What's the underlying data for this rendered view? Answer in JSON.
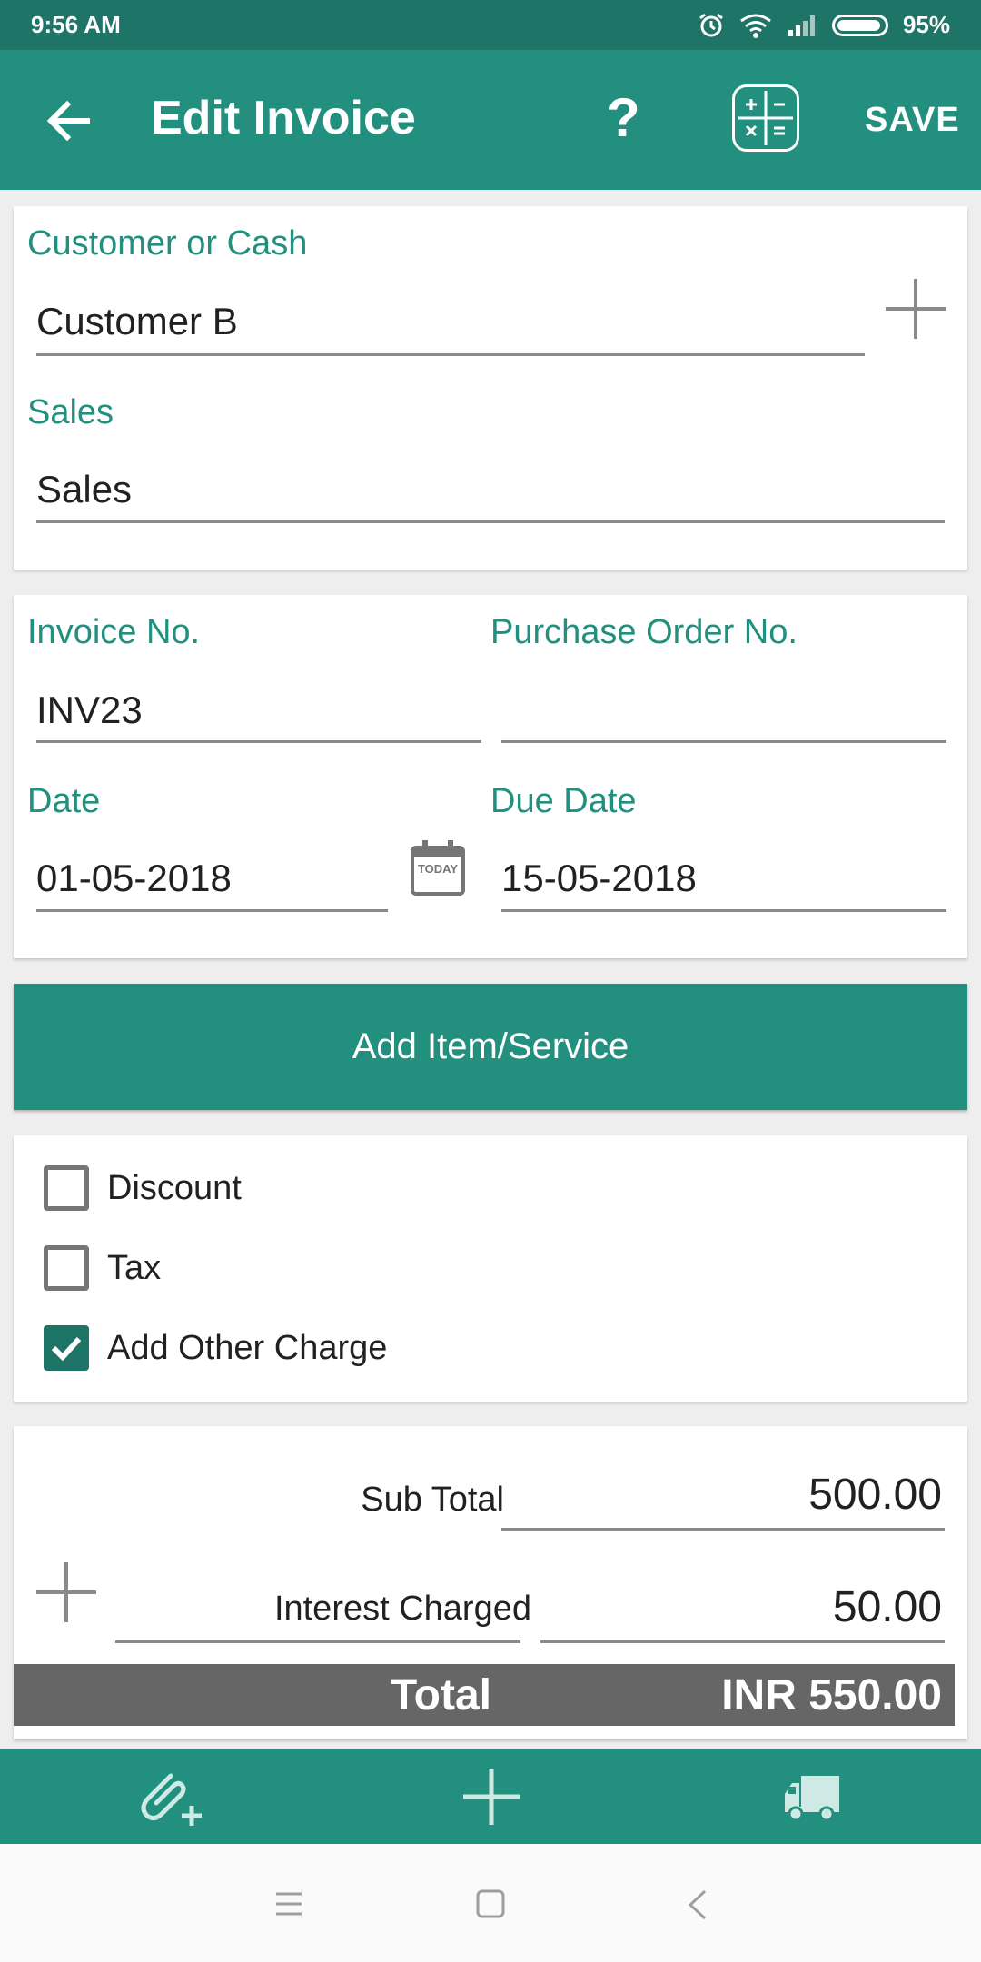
{
  "status_bar": {
    "time": "9:56 AM",
    "battery_text": "95%",
    "battery_level": 0.95,
    "icons": [
      "alarm-icon",
      "wifi-icon",
      "signal-icon",
      "battery-icon"
    ]
  },
  "app_bar": {
    "title": "Edit Invoice",
    "help_label": "?",
    "save_label": "SAVE",
    "icons": [
      "back-arrow-icon",
      "help-icon",
      "calculator-icon"
    ]
  },
  "customer_section": {
    "customer_label": "Customer or Cash",
    "customer_value": "Customer B",
    "sales_label": "Sales",
    "sales_value": "Sales"
  },
  "invoice_section": {
    "invoice_no_label": "Invoice No.",
    "invoice_no_value": "INV23",
    "po_label": "Purchase Order No.",
    "po_value": "",
    "date_label": "Date",
    "date_value": "01-05-2018",
    "today_icon_text": "TODAY",
    "due_date_label": "Due Date",
    "due_date_value": "15-05-2018"
  },
  "add_item_label": "Add Item/Service",
  "options": [
    {
      "label": "Discount",
      "checked": false
    },
    {
      "label": "Tax",
      "checked": false
    },
    {
      "label": "Add Other Charge",
      "checked": true
    }
  ],
  "totals": {
    "subtotal_label": "Sub Total",
    "subtotal_value": "500.00",
    "other_charge_label": "Interest Charged",
    "other_charge_value": "50.00",
    "total_label": "Total",
    "total_value": "INR 550.00"
  },
  "bottom_bar": {
    "icons": [
      "attach-add-icon",
      "plus-icon",
      "truck-icon"
    ]
  },
  "nav_bar": {
    "icons": [
      "menu-icon",
      "home-icon",
      "back-icon"
    ]
  },
  "colors": {
    "primary": "#23907f",
    "primary_dark": "#1e7467",
    "total_bar": "#666666"
  }
}
